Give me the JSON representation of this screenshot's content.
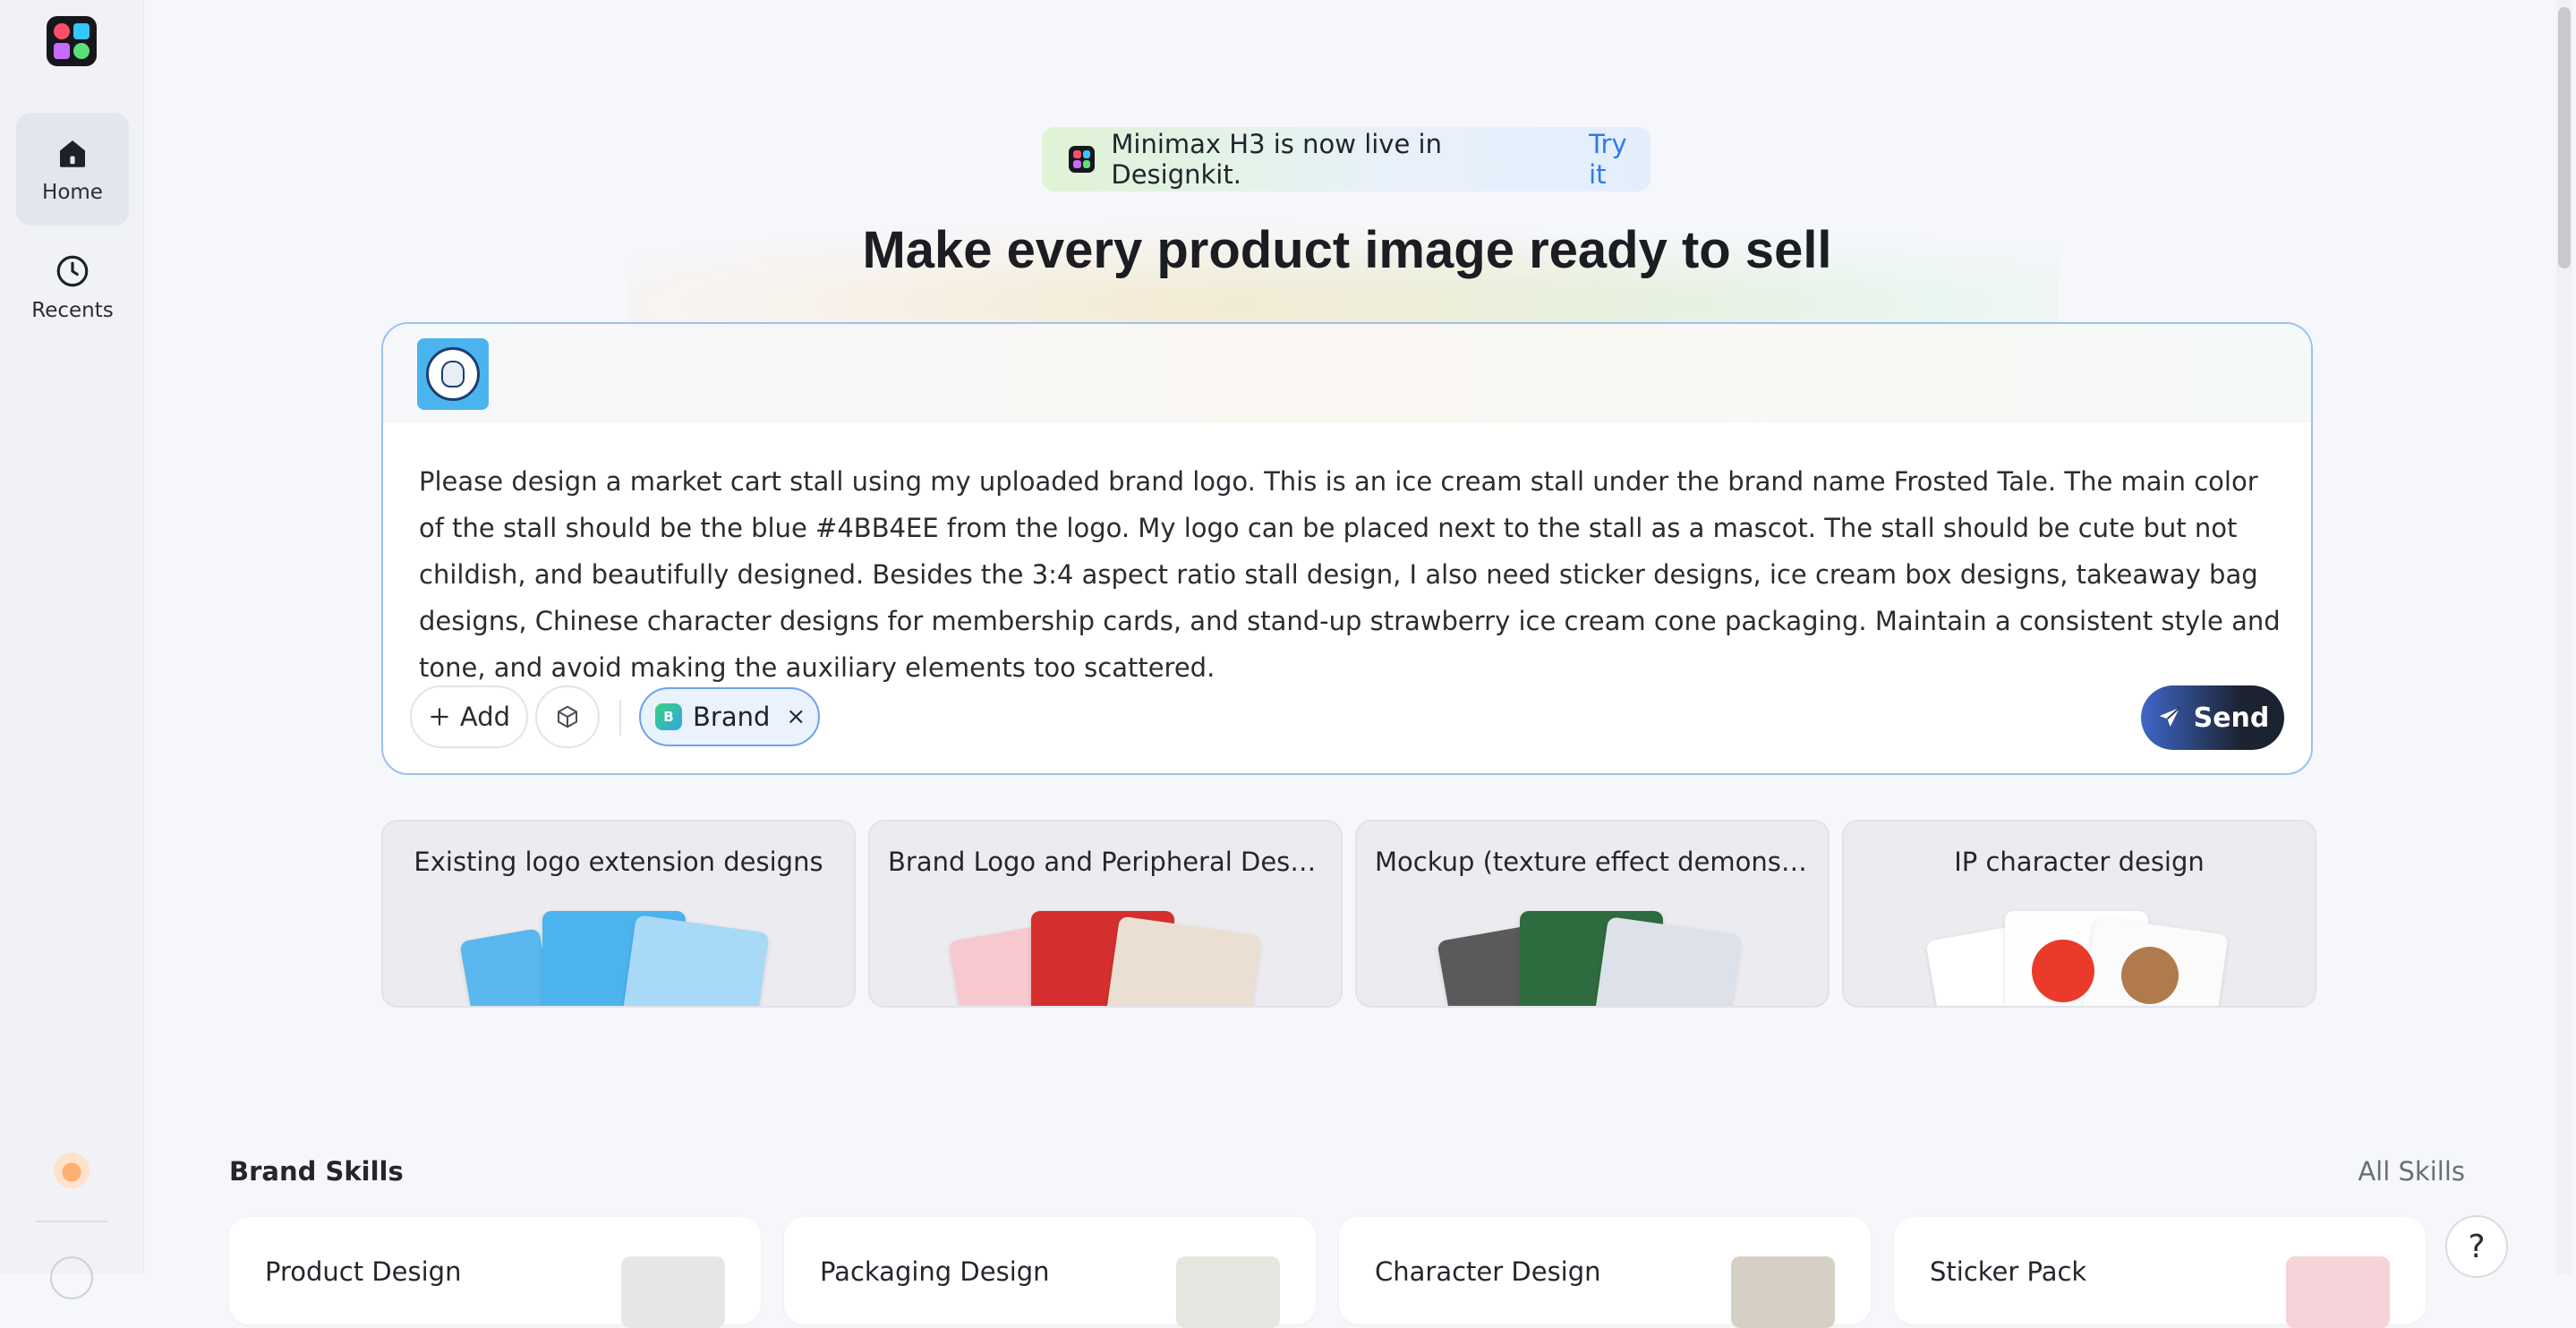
{
  "sidebar": {
    "items": [
      {
        "label": "Home",
        "icon": "home-icon",
        "active": true
      },
      {
        "label": "Recents",
        "icon": "clock-icon",
        "active": false
      }
    ]
  },
  "announcement": {
    "text": "Minimax H3 is now live in Designkit.",
    "link": "Try it"
  },
  "headline": "Make every product image ready to sell",
  "composer": {
    "prompt": "Please design a market cart stall using my uploaded brand logo. This is an ice cream stall under the brand name Frosted Tale. The main color of the stall should be the blue #4BB4EE from the logo. My logo can be placed next to the stall as a mascot. The stall should be cute but not childish, and beautifully designed. Besides the 3:4 aspect ratio stall design, I also need sticker designs, ice cream box designs, takeaway bag designs, Chinese character designs for membership cards, and stand-up strawberry ice cream cone packaging. Maintain a consistent style and tone, and avoid making the auxiliary elements too scattered.",
    "add_label": "Add",
    "chip_label": "Brand",
    "chip_close": "×",
    "send_label": "Send",
    "brand_color": "#4BB4EE"
  },
  "templates": [
    {
      "title": "Existing logo extension designs"
    },
    {
      "title": "Brand Logo and Peripheral Design"
    },
    {
      "title": "Mockup (texture effect demonstr..."
    },
    {
      "title": "IP character design"
    }
  ],
  "skills": {
    "title": "Brand Skills",
    "all_label": "All Skills",
    "items": [
      {
        "name": "Product Design"
      },
      {
        "name": "Packaging Design"
      },
      {
        "name": "Character Design"
      },
      {
        "name": "Sticker Pack"
      }
    ]
  },
  "help_label": "?"
}
